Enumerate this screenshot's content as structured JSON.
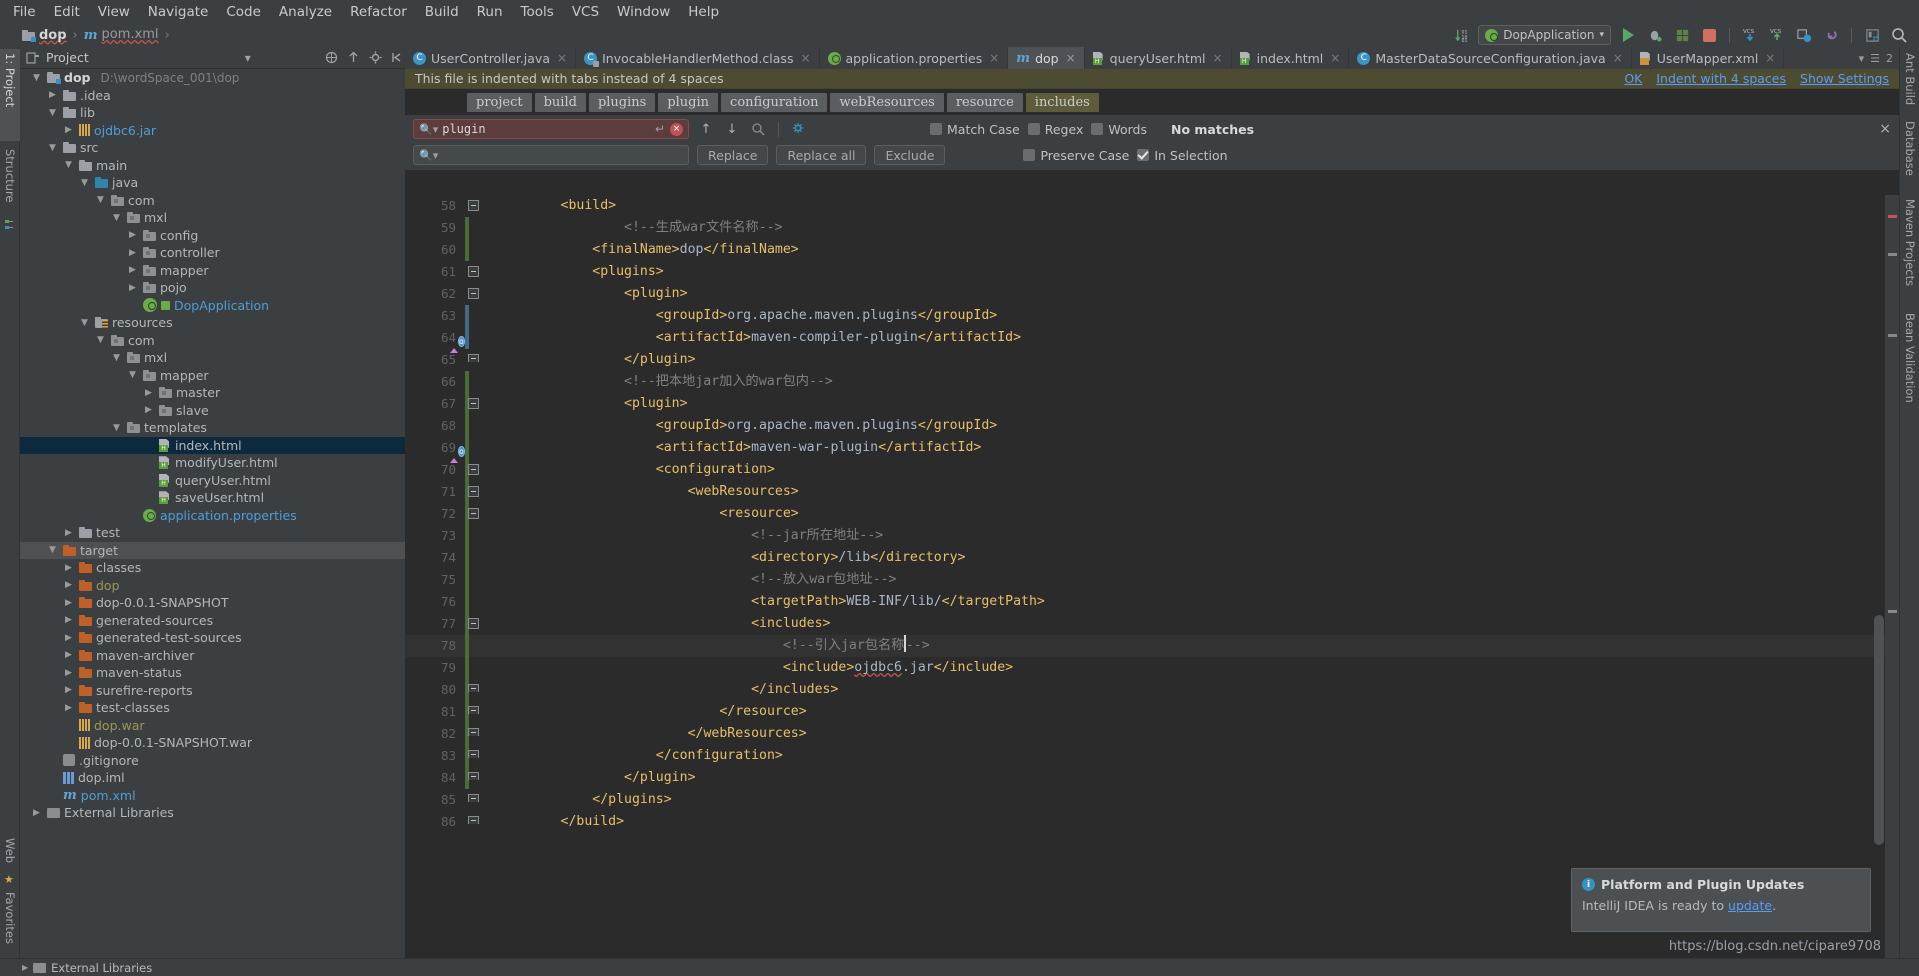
{
  "menubar": {
    "items": [
      "File",
      "Edit",
      "View",
      "Navigate",
      "Code",
      "Analyze",
      "Refactor",
      "Build",
      "Run",
      "Tools",
      "VCS",
      "Window",
      "Help"
    ]
  },
  "breadcrumb": {
    "project": "dop",
    "file": "pom.xml",
    "separator": "›"
  },
  "toolbar_right": {
    "run_config": "DopApplication",
    "dropdown_caret": "▾",
    "icons": [
      "sort-numeric-icon",
      "run-icon",
      "debug-icon",
      "run-coverage-icon",
      "stop-icon",
      "vcs-update-icon",
      "vcs-commit-icon",
      "sync-icon",
      "undo-icon",
      "project-structure-icon",
      "search-everywhere-icon"
    ]
  },
  "left_strip": {
    "tabs": [
      "1: Project",
      "Structure",
      "Favorites",
      "Web"
    ]
  },
  "right_strip": {
    "tabs": [
      "Ant Build",
      "Database",
      "Maven Projects",
      "Bean Validation"
    ]
  },
  "project_panel": {
    "title": "Project",
    "header_icons": [
      "collapse-icon",
      "locate-icon",
      "settings-icon",
      "hide-icon"
    ],
    "tree": [
      {
        "depth": 0,
        "arrow": "▼",
        "icon": "module-folder",
        "label": "dop",
        "style": "bold",
        "path": "D:\\wordSpace_001\\dop"
      },
      {
        "depth": 1,
        "arrow": "▶",
        "icon": "folder",
        "label": ".idea",
        "style": "plain"
      },
      {
        "depth": 1,
        "arrow": "▼",
        "icon": "folder",
        "label": "lib",
        "style": "plain"
      },
      {
        "depth": 2,
        "arrow": "▶",
        "icon": "jar",
        "label": "ojdbc6.jar",
        "style": "blue"
      },
      {
        "depth": 1,
        "arrow": "▼",
        "icon": "folder",
        "label": "src",
        "style": "plain"
      },
      {
        "depth": 2,
        "arrow": "▼",
        "icon": "folder",
        "label": "main",
        "style": "plain"
      },
      {
        "depth": 3,
        "arrow": "▼",
        "icon": "source-folder",
        "label": "java",
        "style": "plain"
      },
      {
        "depth": 4,
        "arrow": "▼",
        "icon": "package",
        "label": "com",
        "style": "plain"
      },
      {
        "depth": 5,
        "arrow": "▼",
        "icon": "package",
        "label": "mxl",
        "style": "plain"
      },
      {
        "depth": 6,
        "arrow": "▶",
        "icon": "package",
        "label": "config",
        "style": "plain"
      },
      {
        "depth": 6,
        "arrow": "▶",
        "icon": "package",
        "label": "controller",
        "style": "plain"
      },
      {
        "depth": 6,
        "arrow": "▶",
        "icon": "package",
        "label": "mapper",
        "style": "plain"
      },
      {
        "depth": 6,
        "arrow": "▶",
        "icon": "package",
        "label": "pojo",
        "style": "plain"
      },
      {
        "depth": 6,
        "arrow": "",
        "icon": "spring-class",
        "label": "DopApplication",
        "style": "blue"
      },
      {
        "depth": 3,
        "arrow": "▼",
        "icon": "resources-folder",
        "label": "resources",
        "style": "plain"
      },
      {
        "depth": 4,
        "arrow": "▼",
        "icon": "package",
        "label": "com",
        "style": "plain"
      },
      {
        "depth": 5,
        "arrow": "▼",
        "icon": "package",
        "label": "mxl",
        "style": "plain"
      },
      {
        "depth": 6,
        "arrow": "▼",
        "icon": "package",
        "label": "mapper",
        "style": "plain"
      },
      {
        "depth": 7,
        "arrow": "▶",
        "icon": "package",
        "label": "master",
        "style": "plain"
      },
      {
        "depth": 7,
        "arrow": "▶",
        "icon": "package",
        "label": "slave",
        "style": "plain"
      },
      {
        "depth": 5,
        "arrow": "▼",
        "icon": "package",
        "label": "templates",
        "style": "plain"
      },
      {
        "depth": 7,
        "arrow": "",
        "icon": "html",
        "label": "index.html",
        "style": "plain",
        "selected": true
      },
      {
        "depth": 7,
        "arrow": "",
        "icon": "html",
        "label": "modifyUser.html",
        "style": "plain"
      },
      {
        "depth": 7,
        "arrow": "",
        "icon": "html",
        "label": "queryUser.html",
        "style": "plain"
      },
      {
        "depth": 7,
        "arrow": "",
        "icon": "html",
        "label": "saveUser.html",
        "style": "plain"
      },
      {
        "depth": 6,
        "arrow": "",
        "icon": "properties",
        "label": "application.properties",
        "style": "blue"
      },
      {
        "depth": 2,
        "arrow": "▶",
        "icon": "folder",
        "label": "test",
        "style": "plain"
      },
      {
        "depth": 1,
        "arrow": "▼",
        "icon": "folder-orange",
        "label": "target",
        "style": "plain",
        "highlight": true
      },
      {
        "depth": 2,
        "arrow": "▶",
        "icon": "folder-orange",
        "label": "classes",
        "style": "plain"
      },
      {
        "depth": 2,
        "arrow": "▶",
        "icon": "folder-orange",
        "label": "dop",
        "style": "olive"
      },
      {
        "depth": 2,
        "arrow": "▶",
        "icon": "folder-orange",
        "label": "dop-0.0.1-SNAPSHOT",
        "style": "plain"
      },
      {
        "depth": 2,
        "arrow": "▶",
        "icon": "folder-orange",
        "label": "generated-sources",
        "style": "plain"
      },
      {
        "depth": 2,
        "arrow": "▶",
        "icon": "folder-orange",
        "label": "generated-test-sources",
        "style": "plain"
      },
      {
        "depth": 2,
        "arrow": "▶",
        "icon": "folder-orange",
        "label": "maven-archiver",
        "style": "plain"
      },
      {
        "depth": 2,
        "arrow": "▶",
        "icon": "folder-orange",
        "label": "maven-status",
        "style": "plain"
      },
      {
        "depth": 2,
        "arrow": "▶",
        "icon": "folder-orange",
        "label": "surefire-reports",
        "style": "plain"
      },
      {
        "depth": 2,
        "arrow": "▶",
        "icon": "folder-orange",
        "label": "test-classes",
        "style": "plain"
      },
      {
        "depth": 2,
        "arrow": "",
        "icon": "jar",
        "label": "dop.war",
        "style": "olive"
      },
      {
        "depth": 2,
        "arrow": "",
        "icon": "jar",
        "label": "dop-0.0.1-SNAPSHOT.war",
        "style": "plain"
      },
      {
        "depth": 1,
        "arrow": "",
        "icon": "gitignore",
        "label": ".gitignore",
        "style": "plain"
      },
      {
        "depth": 1,
        "arrow": "",
        "icon": "iml",
        "label": "dop.iml",
        "style": "plain"
      },
      {
        "depth": 1,
        "arrow": "",
        "icon": "maven",
        "label": "pom.xml",
        "style": "blue"
      },
      {
        "depth": 0,
        "arrow": "▶",
        "icon": "lib",
        "label": "External Libraries",
        "style": "plain"
      }
    ]
  },
  "editor_tabs": [
    {
      "label": "UserController.java",
      "icon": "java-class-icon",
      "active": false
    },
    {
      "label": "InvocableHandlerMethod.class",
      "icon": "compiled-class-icon",
      "active": false
    },
    {
      "label": "application.properties",
      "icon": "spring-properties-icon",
      "active": false
    },
    {
      "label": "dop",
      "icon": "maven-icon",
      "active": true
    },
    {
      "label": "queryUser.html",
      "icon": "html-icon",
      "active": false
    },
    {
      "label": "index.html",
      "icon": "html-icon",
      "active": false
    },
    {
      "label": "MasterDataSourceConfiguration.java",
      "icon": "java-class-icon",
      "active": false
    },
    {
      "label": "UserMapper.xml",
      "icon": "xml-icon",
      "active": false
    }
  ],
  "editor_tabbar_right": {
    "count": "2",
    "caret": "▾"
  },
  "notification": {
    "message": "This file is indented with tabs instead of 4 spaces",
    "actions": [
      "OK",
      "Indent with 4 spaces",
      "Show Settings"
    ]
  },
  "xml_breadcrumb": {
    "chips": [
      "project",
      "build",
      "plugins",
      "plugin",
      "configuration",
      "webResources",
      "resource",
      "includes"
    ]
  },
  "find_replace": {
    "search_value": "plugin",
    "search_icon": "search-icon",
    "replace_placeholder": "",
    "buttons": [
      "Replace",
      "Replace all",
      "Exclude"
    ],
    "checkboxes_row1": [
      {
        "label": "Match Case",
        "checked": false
      },
      {
        "label": "Regex",
        "checked": false
      },
      {
        "label": "Words",
        "checked": false
      }
    ],
    "checkboxes_row2": [
      {
        "label": "Preserve Case",
        "checked": false
      },
      {
        "label": "In Selection",
        "checked": true
      }
    ],
    "status": "No matches",
    "nav_icons": [
      "find-prev-icon",
      "find-next-icon",
      "find-in-selection-icon",
      "filter-settings-icon"
    ],
    "close_icon": "close-icon"
  },
  "code": {
    "first_line": 58,
    "lines": [
      {
        "n": 58,
        "fold": "minus",
        "indent": 4,
        "segs": [
          {
            "t": "tag",
            "v": "<build>"
          }
        ]
      },
      {
        "n": 59,
        "fold": "",
        "indent": 8,
        "change": "green",
        "segs": [
          {
            "t": "cmt",
            "v": "<!--生成war文件名称-->"
          }
        ]
      },
      {
        "n": 60,
        "fold": "",
        "indent": 6,
        "change": "green",
        "segs": [
          {
            "t": "tag",
            "v": "<finalName>"
          },
          {
            "t": "txt",
            "v": "dop"
          },
          {
            "t": "tag",
            "v": "</finalName>"
          }
        ]
      },
      {
        "n": 61,
        "fold": "minus",
        "indent": 6,
        "segs": [
          {
            "t": "tag",
            "v": "<plugins>"
          }
        ]
      },
      {
        "n": 62,
        "fold": "minus",
        "indent": 8,
        "segs": [
          {
            "t": "tag",
            "v": "<plugin>"
          }
        ]
      },
      {
        "n": 63,
        "fold": "",
        "indent": 10,
        "change": "blue",
        "segs": [
          {
            "t": "tag",
            "v": "<groupId>"
          },
          {
            "t": "txt",
            "v": "org.apache.maven.plugins"
          },
          {
            "t": "tag",
            "v": "</groupId>"
          }
        ]
      },
      {
        "n": 64,
        "fold": "",
        "indent": 10,
        "change": "blue",
        "mark": "run",
        "segs": [
          {
            "t": "tag",
            "v": "<artifactId>"
          },
          {
            "t": "txt",
            "v": "maven-compiler-plugin"
          },
          {
            "t": "tag",
            "v": "</artifactId>"
          }
        ]
      },
      {
        "n": 65,
        "fold": "end",
        "indent": 8,
        "segs": [
          {
            "t": "tag",
            "v": "</plugin>"
          }
        ]
      },
      {
        "n": 66,
        "fold": "",
        "indent": 8,
        "change": "green",
        "segs": [
          {
            "t": "cmt",
            "v": "<!--把本地jar加入的war包内-->"
          }
        ]
      },
      {
        "n": 67,
        "fold": "minus",
        "indent": 8,
        "change": "green",
        "segs": [
          {
            "t": "tag",
            "v": "<plugin>"
          }
        ]
      },
      {
        "n": 68,
        "fold": "",
        "indent": 10,
        "change": "green",
        "segs": [
          {
            "t": "tag",
            "v": "<groupId>"
          },
          {
            "t": "txt",
            "v": "org.apache.maven.plugins"
          },
          {
            "t": "tag",
            "v": "</groupId>"
          }
        ]
      },
      {
        "n": 69,
        "fold": "",
        "indent": 10,
        "change": "green",
        "mark": "run",
        "segs": [
          {
            "t": "tag",
            "v": "<artifactId>"
          },
          {
            "t": "txt",
            "v": "maven-war-plugin"
          },
          {
            "t": "tag",
            "v": "</artifactId>"
          }
        ]
      },
      {
        "n": 70,
        "fold": "minus",
        "indent": 10,
        "change": "green",
        "segs": [
          {
            "t": "tag",
            "v": "<configuration>"
          }
        ]
      },
      {
        "n": 71,
        "fold": "minus",
        "indent": 12,
        "change": "green",
        "segs": [
          {
            "t": "tag",
            "v": "<webResources>"
          }
        ]
      },
      {
        "n": 72,
        "fold": "minus",
        "indent": 14,
        "change": "green",
        "segs": [
          {
            "t": "tag",
            "v": "<resource>"
          }
        ]
      },
      {
        "n": 73,
        "fold": "",
        "indent": 16,
        "change": "green",
        "segs": [
          {
            "t": "cmt",
            "v": "<!--jar所在地址-->"
          }
        ]
      },
      {
        "n": 74,
        "fold": "",
        "indent": 16,
        "change": "green",
        "segs": [
          {
            "t": "tag",
            "v": "<directory>"
          },
          {
            "t": "txt",
            "v": "/lib"
          },
          {
            "t": "tag",
            "v": "</directory>"
          }
        ]
      },
      {
        "n": 75,
        "fold": "",
        "indent": 16,
        "change": "green",
        "segs": [
          {
            "t": "cmt",
            "v": "<!--放入war包地址-->"
          }
        ]
      },
      {
        "n": 76,
        "fold": "",
        "indent": 16,
        "change": "green",
        "segs": [
          {
            "t": "tag",
            "v": "<targetPath>"
          },
          {
            "t": "txt",
            "v": "WEB-INF/lib/"
          },
          {
            "t": "tag",
            "v": "</targetPath>"
          }
        ]
      },
      {
        "n": 77,
        "fold": "minus",
        "indent": 16,
        "change": "green",
        "segs": [
          {
            "t": "tag",
            "v": "<includes>"
          }
        ]
      },
      {
        "n": 78,
        "fold": "",
        "indent": 18,
        "change": "green",
        "current": true,
        "segs": [
          {
            "t": "cmt",
            "v": "<!--引入jar包名称"
          },
          {
            "t": "caret",
            "v": ""
          },
          {
            "t": "cmt",
            "v": "-->"
          }
        ]
      },
      {
        "n": 79,
        "fold": "",
        "indent": 18,
        "change": "green",
        "segs": [
          {
            "t": "tag",
            "v": "<include>"
          },
          {
            "t": "typo",
            "v": "ojdbc6"
          },
          {
            "t": "txt",
            "v": ".jar"
          },
          {
            "t": "tag",
            "v": "</include>"
          }
        ]
      },
      {
        "n": 80,
        "fold": "end",
        "indent": 16,
        "change": "green",
        "segs": [
          {
            "t": "tag",
            "v": "</includes>"
          }
        ]
      },
      {
        "n": 81,
        "fold": "end",
        "indent": 14,
        "change": "green",
        "segs": [
          {
            "t": "tag",
            "v": "</resource>"
          }
        ]
      },
      {
        "n": 82,
        "fold": "end",
        "indent": 12,
        "change": "green",
        "segs": [
          {
            "t": "tag",
            "v": "</webResources>"
          }
        ]
      },
      {
        "n": 83,
        "fold": "end",
        "indent": 10,
        "change": "green",
        "segs": [
          {
            "t": "tag",
            "v": "</configuration>"
          }
        ]
      },
      {
        "n": 84,
        "fold": "end",
        "indent": 8,
        "change": "green",
        "segs": [
          {
            "t": "tag",
            "v": "</plugin>"
          }
        ]
      },
      {
        "n": 85,
        "fold": "end",
        "indent": 6,
        "segs": [
          {
            "t": "tag",
            "v": "</plugins>"
          }
        ]
      },
      {
        "n": 86,
        "fold": "end",
        "indent": 4,
        "segs": [
          {
            "t": "tag",
            "v": "</build>"
          }
        ]
      }
    ]
  },
  "popup": {
    "title": "Platform and Plugin Updates",
    "body_prefix": "IntelliJ IDEA is ready to ",
    "body_link": "update",
    "body_suffix": ".",
    "icon": "info-icon"
  },
  "watermark": "https://blog.csdn.net/cipare9708",
  "bottom_bar": {
    "label": "External Libraries"
  },
  "colors": {
    "bg": "#3c3f41",
    "editor_bg": "#2b2b2b",
    "tag": "#e8bf6a",
    "comment": "#808080",
    "text": "#a9b7c6",
    "accent_blue": "#589df6",
    "selection": "#0d293e",
    "notif_bg": "#4e4b33",
    "find_error": "#5c3c3c",
    "green_run": "#59a869"
  }
}
